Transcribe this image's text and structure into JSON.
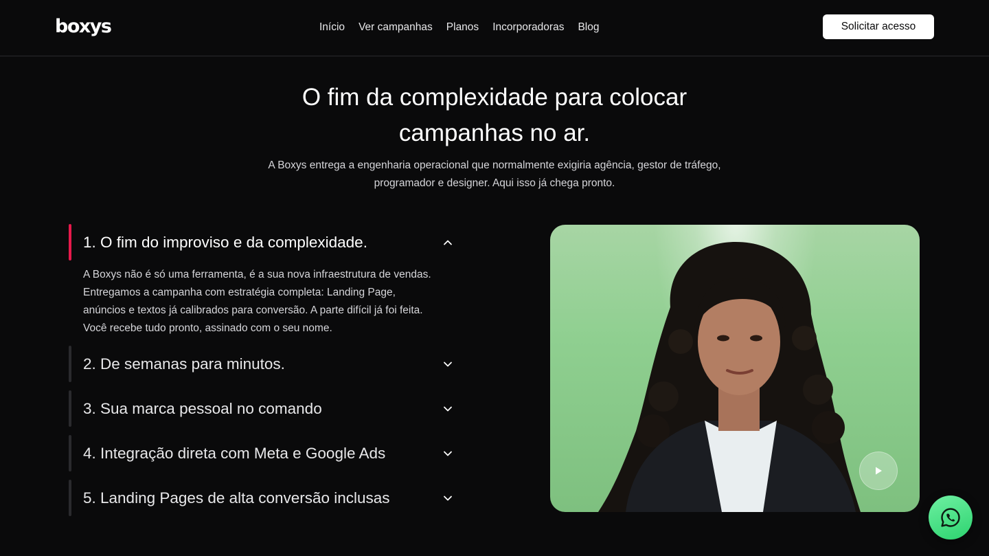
{
  "header": {
    "logo": "boxys",
    "nav": [
      "Início",
      "Ver campanhas",
      "Planos",
      "Incorporadoras",
      "Blog"
    ],
    "cta_label": "Solicitar acesso"
  },
  "hero": {
    "title_line1": "O fim da complexidade para colocar",
    "title_line2": "campanhas no ar.",
    "subtitle_line1": "A Boxys entrega a engenharia operacional que normalmente exigiria agência, gestor de tráfego,",
    "subtitle_line2": "programador e designer. Aqui isso já chega pronto."
  },
  "accordion": {
    "items": [
      {
        "title": "1. O fim do improviso e da complexidade.",
        "open": true,
        "body_lines": [
          "A Boxys não é só uma ferramenta, é a sua nova infraestrutura de vendas.",
          "Entregamos a campanha com estratégia completa: Landing Page,",
          "anúncios e textos já calibrados para conversão. A parte difícil já foi feita.",
          "Você recebe tudo pronto, assinado com o seu nome."
        ]
      },
      {
        "title": "2. De semanas para minutos.",
        "open": false
      },
      {
        "title": "3. Sua marca pessoal no comando",
        "open": false
      },
      {
        "title": "4. Integração direta com Meta e Google Ads",
        "open": false
      },
      {
        "title": "5. Landing Pages de alta conversão inclusas",
        "open": false
      }
    ],
    "accent_color": "#e6194b"
  },
  "video": {
    "icon": "play-icon"
  },
  "whatsapp": {
    "icon": "whatsapp-icon"
  }
}
